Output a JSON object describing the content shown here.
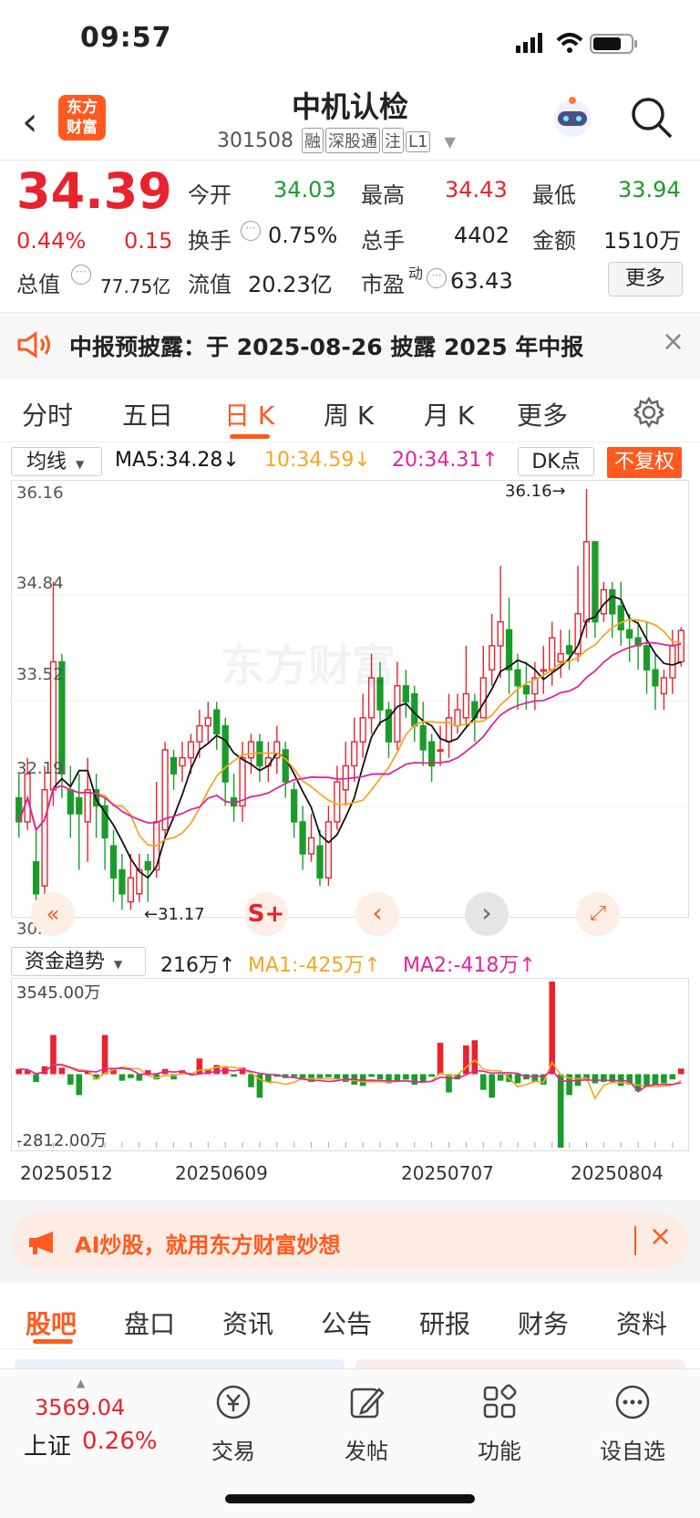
{
  "status": {
    "time": "09:57"
  },
  "header": {
    "logo_line1": "东方",
    "logo_line2": "财富",
    "title": "中机认检",
    "code": "301508",
    "tags": [
      "融",
      "深股通",
      "注",
      "L1"
    ]
  },
  "quote": {
    "price": "34.39",
    "change_pct": "0.44%",
    "change": "0.15",
    "open_label": "今开",
    "open": "34.03",
    "high_label": "最高",
    "high": "34.43",
    "low_label": "最低",
    "low": "33.94",
    "turnover_label": "换手",
    "turnover": "0.75%",
    "volume_label": "总手",
    "volume": "4402",
    "amount_label": "金额",
    "amount": "1510万",
    "mktcap_label": "总值",
    "mktcap": "77.75亿",
    "float_label": "流值",
    "float": "20.23亿",
    "pe_label": "市盈",
    "pe_sup": "动",
    "pe": "63.43",
    "more": "更多"
  },
  "notice": {
    "text": "中报预披露：于 2025-08-26 披露 2025 年中报"
  },
  "period_tabs": [
    {
      "label": "分时"
    },
    {
      "label": "五日"
    },
    {
      "label": "日 K"
    },
    {
      "label": "周 K"
    },
    {
      "label": "月 K"
    },
    {
      "label": "更多"
    }
  ],
  "indicator_bar": {
    "ma_select": "均线",
    "ma5": "MA5:34.28↓",
    "ma10": "10:34.59↓",
    "ma20": "20:34.31↑",
    "dk": "DK点",
    "adjust": "不复权"
  },
  "kline_axis": {
    "y_ticks": [
      "36.16",
      "34.84",
      "33.52",
      "32.19",
      "30.87"
    ],
    "max_label": "36.16→",
    "min_label": "←31.17",
    "watermark": "东方财富"
  },
  "flow_bar": {
    "select": "资金趋势",
    "value": "216万↑",
    "ma1": "MA1:-425万↑",
    "ma2": "MA2:-418万↑",
    "y_top": "3545.00万",
    "y_bottom": "-2812.00万",
    "dates": [
      "20250512",
      "20250609",
      "20250707",
      "20250804"
    ]
  },
  "ad": {
    "text": "AI炒股，就用东方财富妙想"
  },
  "bottom_tabs": [
    {
      "label": "股吧"
    },
    {
      "label": "盘口"
    },
    {
      "label": "资讯"
    },
    {
      "label": "公告"
    },
    {
      "label": "研报"
    },
    {
      "label": "财务"
    },
    {
      "label": "资料"
    }
  ],
  "nav": {
    "index_value": "3569.04",
    "index_name": "上证",
    "index_pct": "0.26%",
    "items": [
      {
        "label": "交易"
      },
      {
        "label": "发帖"
      },
      {
        "label": "功能"
      },
      {
        "label": "设自选"
      }
    ]
  },
  "colors": {
    "up": "#e8232d",
    "down": "#1a9c2a",
    "accent": "#ff5a1f",
    "ma5": "#111111",
    "ma10": "#f5a623",
    "ma20": "#e0249a"
  },
  "chart_data": [
    {
      "type": "candlestick",
      "ylim": [
        30.87,
        36.16
      ],
      "candles": [
        [
          32.3,
          32.0,
          32.6,
          31.8
        ],
        [
          32.0,
          32.6,
          32.8,
          31.9
        ],
        [
          31.5,
          31.1,
          31.9,
          30.9
        ],
        [
          31.2,
          32.4,
          32.7,
          30.9
        ],
        [
          32.4,
          34.0,
          35.0,
          32.2
        ],
        [
          34.0,
          32.6,
          34.1,
          32.3
        ],
        [
          32.4,
          32.1,
          32.7,
          31.8
        ],
        [
          32.3,
          32.1,
          32.6,
          31.4
        ],
        [
          32.0,
          32.4,
          32.8,
          31.5
        ],
        [
          32.4,
          32.2,
          32.6,
          31.8
        ],
        [
          32.2,
          31.8,
          32.3,
          31.4
        ],
        [
          31.7,
          31.3,
          31.9,
          31.0
        ],
        [
          31.4,
          31.1,
          31.6,
          30.9
        ],
        [
          31.0,
          31.3,
          31.6,
          30.9
        ],
        [
          31.1,
          31.4,
          31.6,
          31.0
        ],
        [
          31.5,
          31.4,
          31.6,
          31.0
        ],
        [
          31.4,
          32.0,
          32.5,
          31.3
        ],
        [
          31.9,
          32.9,
          33.0,
          31.8
        ],
        [
          32.8,
          32.6,
          32.9,
          32.4
        ],
        [
          32.7,
          32.8,
          33.0,
          32.5
        ],
        [
          32.8,
          33.0,
          33.1,
          32.6
        ],
        [
          33.0,
          33.2,
          33.4,
          32.8
        ],
        [
          33.2,
          33.3,
          33.5,
          33.0
        ],
        [
          33.4,
          33.1,
          33.5,
          32.9
        ],
        [
          33.2,
          32.5,
          33.3,
          32.2
        ],
        [
          32.3,
          32.2,
          32.6,
          32.0
        ],
        [
          32.2,
          32.8,
          33.0,
          32.0
        ],
        [
          32.8,
          33.0,
          33.1,
          32.6
        ],
        [
          33.0,
          32.7,
          33.1,
          32.5
        ],
        [
          32.7,
          32.8,
          33.0,
          32.5
        ],
        [
          32.8,
          33.0,
          33.2,
          32.6
        ],
        [
          32.9,
          32.5,
          33.0,
          32.3
        ],
        [
          32.4,
          32.0,
          32.5,
          31.8
        ],
        [
          32.0,
          31.6,
          32.2,
          31.4
        ],
        [
          31.6,
          31.8,
          32.1,
          31.5
        ],
        [
          31.7,
          31.3,
          31.9,
          31.2
        ],
        [
          31.3,
          32.0,
          32.2,
          31.2
        ],
        [
          32.0,
          32.5,
          32.7,
          31.9
        ],
        [
          32.4,
          32.7,
          33.0,
          32.2
        ],
        [
          32.7,
          33.0,
          33.3,
          32.5
        ],
        [
          33.0,
          33.3,
          33.6,
          32.8
        ],
        [
          33.3,
          33.8,
          34.1,
          33.1
        ],
        [
          33.8,
          33.4,
          34.0,
          33.2
        ],
        [
          33.4,
          33.0,
          33.5,
          32.8
        ],
        [
          33.0,
          33.7,
          34.0,
          32.9
        ],
        [
          33.7,
          33.5,
          33.9,
          33.3
        ],
        [
          33.6,
          33.2,
          33.7,
          33.0
        ],
        [
          33.2,
          32.9,
          33.5,
          32.7
        ],
        [
          33.0,
          32.7,
          33.1,
          32.5
        ],
        [
          32.9,
          32.9,
          33.2,
          32.7
        ],
        [
          33.0,
          33.3,
          33.6,
          32.8
        ],
        [
          33.2,
          33.4,
          33.6,
          33.1
        ],
        [
          33.3,
          33.6,
          34.2,
          33.2
        ],
        [
          33.5,
          33.3,
          33.6,
          33.0
        ],
        [
          33.3,
          33.8,
          34.2,
          33.3
        ],
        [
          33.9,
          34.2,
          34.6,
          33.7
        ],
        [
          34.2,
          34.5,
          35.2,
          33.8
        ],
        [
          34.4,
          33.9,
          34.8,
          33.6
        ],
        [
          33.9,
          33.7,
          34.1,
          33.4
        ],
        [
          33.7,
          33.6,
          34.0,
          33.4
        ],
        [
          33.6,
          33.8,
          34.0,
          33.4
        ],
        [
          33.9,
          33.9,
          34.2,
          33.6
        ],
        [
          33.9,
          34.3,
          34.5,
          33.7
        ],
        [
          34.0,
          34.1,
          34.4,
          33.8
        ],
        [
          34.2,
          34.1,
          34.4,
          33.9
        ],
        [
          34.1,
          34.6,
          35.2,
          34.0
        ],
        [
          34.5,
          35.5,
          36.16,
          34.3
        ],
        [
          35.5,
          34.5,
          35.5,
          34.3
        ],
        [
          34.6,
          34.9,
          35.0,
          34.5
        ],
        [
          34.9,
          34.6,
          35.0,
          34.3
        ],
        [
          34.7,
          34.4,
          35.0,
          34.2
        ],
        [
          34.4,
          34.3,
          34.6,
          34.0
        ],
        [
          34.3,
          34.2,
          34.5,
          33.9
        ],
        [
          34.2,
          33.9,
          34.5,
          33.6
        ],
        [
          33.9,
          33.7,
          34.1,
          33.4
        ],
        [
          33.6,
          33.8,
          33.9,
          33.4
        ],
        [
          33.8,
          34.2,
          34.4,
          33.6
        ],
        [
          34.0,
          34.39,
          34.43,
          33.94
        ]
      ]
    },
    {
      "type": "bar",
      "ylim": [
        -2812,
        3545
      ],
      "values": [
        200,
        150,
        -300,
        300,
        1500,
        250,
        -400,
        -800,
        120,
        -200,
        1500,
        200,
        -250,
        -150,
        -250,
        150,
        -200,
        200,
        -200,
        150,
        50,
        600,
        200,
        350,
        250,
        -100,
        250,
        -500,
        -900,
        -300,
        -100,
        -150,
        -100,
        -200,
        -300,
        -150,
        -120,
        -200,
        -300,
        -400,
        -450,
        -100,
        -200,
        -350,
        -300,
        -200,
        -400,
        -300,
        -100,
        1200,
        -700,
        -200,
        1100,
        1300,
        -600,
        -900,
        -250,
        -300,
        -350,
        -200,
        -300,
        -400,
        3545,
        -2812,
        -800,
        -450,
        -200,
        -350,
        -300,
        -300,
        -450,
        -400,
        -650,
        -500,
        -400,
        -350,
        -200,
        216
      ]
    }
  ]
}
